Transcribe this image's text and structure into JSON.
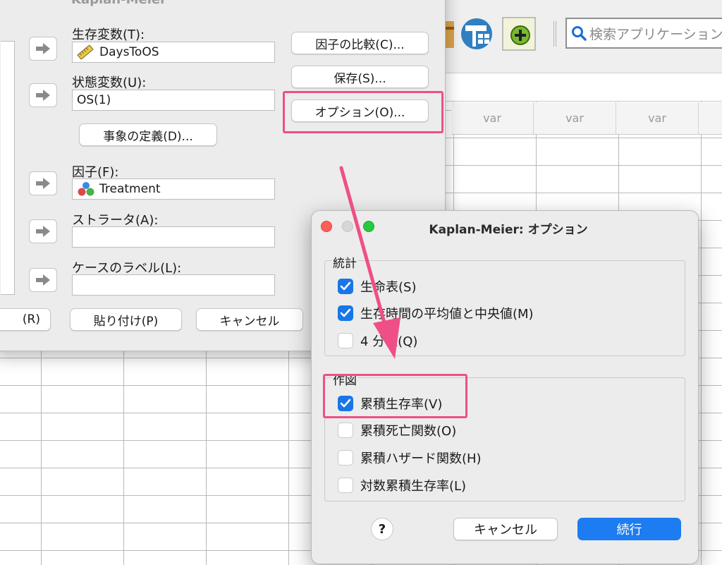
{
  "background": {
    "search_placeholder": "検索アプリケーション",
    "var_headers": [
      "var",
      "var",
      "var"
    ]
  },
  "km_dialog": {
    "title": "Kaplan-Meier",
    "time_label": "生存変数(T):",
    "time_value": "DaysToOS",
    "status_label": "状態変数(U):",
    "status_value": "OS(1)",
    "define_event_button": "事象の定義(D)...",
    "factor_label": "因子(F):",
    "factor_value": "Treatment",
    "strata_label": "ストラータ(A):",
    "strata_value": "",
    "case_label_label": "ケースのラベル(L):",
    "case_label_value": "",
    "compare_factor_button": "因子の比較(C)...",
    "save_button": "保存(S)...",
    "options_button": "オプション(O)...",
    "reset_button": "(R)",
    "paste_button": "貼り付け(P)",
    "cancel_button": "キャンセル"
  },
  "options_dialog": {
    "title": "Kaplan-Meier: オプション",
    "statistics_group": "統計",
    "statistics": [
      {
        "label": "生命表(S)",
        "checked": true
      },
      {
        "label": "生存時間の平均値と中央値(M)",
        "checked": true
      },
      {
        "label": "4 分位(Q)",
        "checked": false
      }
    ],
    "plots_group": "作図",
    "plots": [
      {
        "label": "累積生存率(V)",
        "checked": true
      },
      {
        "label": "累積死亡関数(O)",
        "checked": false
      },
      {
        "label": "累積ハザード関数(H)",
        "checked": false
      },
      {
        "label": "対数累積生存率(L)",
        "checked": false
      }
    ],
    "help_button": "?",
    "cancel_button": "キャンセル",
    "continue_button": "続行"
  },
  "colors": {
    "highlight": "#ef4f86",
    "accent_blue": "#1d7cf2"
  }
}
